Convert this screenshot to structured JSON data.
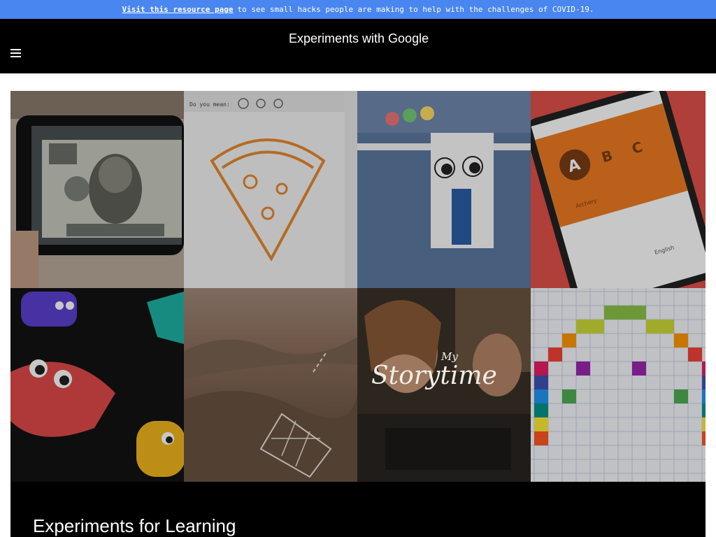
{
  "banner": {
    "link_text": "Visit this resource page",
    "text": "to see small hacks people are making to help with the challenges of COVID-19."
  },
  "header": {
    "site_title": "Experiments with Google",
    "menu_icon": "hamburger-menu-icon"
  },
  "tiles": {
    "t5": {
      "letters": [
        "A",
        "B",
        "C"
      ],
      "caption": "Archery",
      "lang": "English"
    },
    "t7": {
      "small": "My",
      "title": "Storytime"
    },
    "t2": {
      "prompt": "Do you mean:"
    }
  },
  "section": {
    "title": "Experiments for Learning"
  },
  "colors": {
    "banner_bg": "#4a86f0",
    "header_bg": "#000000",
    "tile_orange": "#ef7b22"
  }
}
